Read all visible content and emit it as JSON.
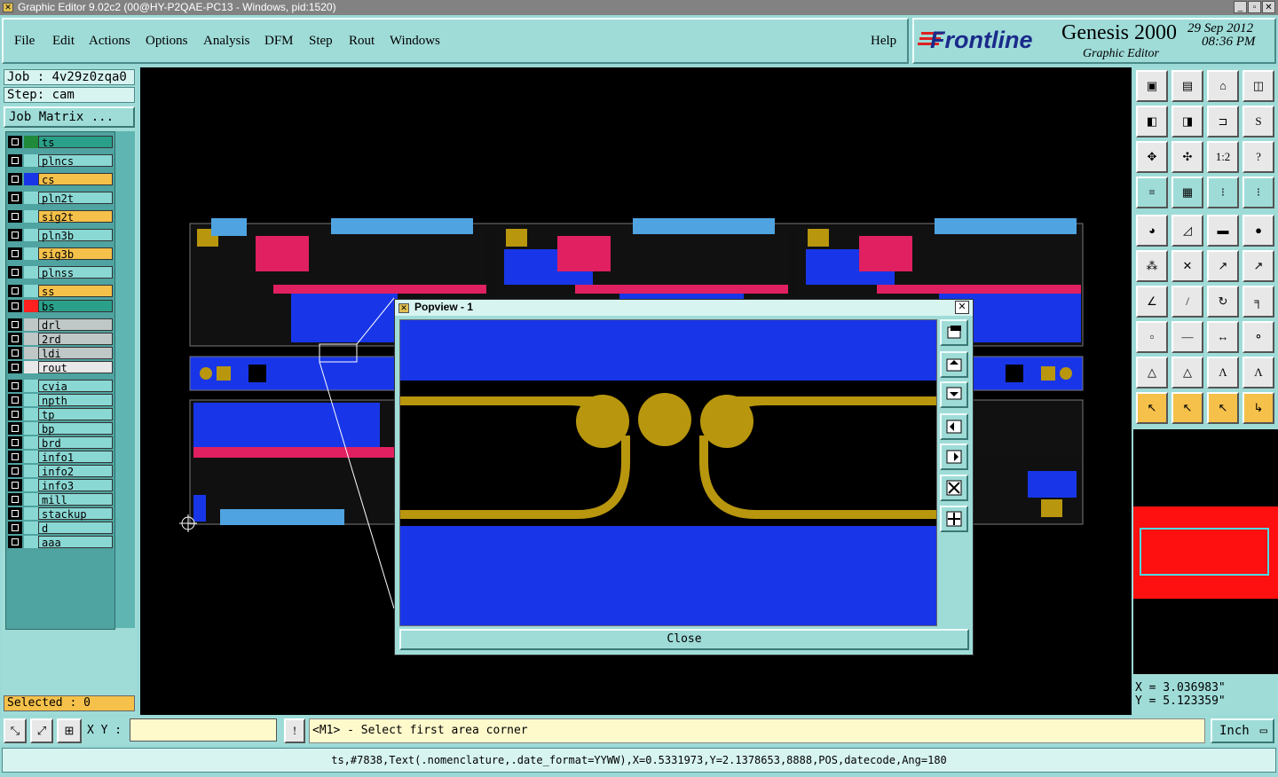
{
  "window": {
    "title": "Graphic Editor 9.02c2 (00@HY-P2QAE-PC13 - Windows, pid:1520)"
  },
  "menu": [
    "File",
    "Edit",
    "Actions",
    "Options",
    "Analysis",
    "DFM",
    "Step",
    "Rout",
    "Windows"
  ],
  "help_label": "Help",
  "brand": {
    "logo": "Frontline",
    "product": "Genesis 2000",
    "subtitle": "Graphic Editor",
    "date": "29 Sep 2012",
    "time": "08:36 PM"
  },
  "job": {
    "job_label": "Job : 4v29z0zqa0",
    "step_label": "Step: cam",
    "matrix_button": "Job Matrix ..."
  },
  "layers": [
    {
      "name": "ts",
      "color": "#1f8a3a",
      "bg": "#2aa08a"
    },
    {
      "name": "plncs",
      "color": "#8ad8d4",
      "bg": "#8ad8d4"
    },
    {
      "name": "cs",
      "color": "#1836e8",
      "bg": "#f5c14a"
    },
    {
      "name": "pln2t",
      "color": "#8ad8d4",
      "bg": "#8ad8d4"
    },
    {
      "name": "sig2t",
      "color": "#8ad8d4",
      "bg": "#f5c14a"
    },
    {
      "name": "pln3b",
      "color": "#8ad8d4",
      "bg": "#8ad8d4"
    },
    {
      "name": "sig3b",
      "color": "#8ad8d4",
      "bg": "#f5c14a"
    },
    {
      "name": "plnss",
      "color": "#8ad8d4",
      "bg": "#8ad8d4"
    },
    {
      "name": "ss",
      "color": "#8ad8d4",
      "bg": "#f5c14a"
    },
    {
      "name": "bs",
      "color": "#ff2020",
      "bg": "#2aa08a"
    },
    {
      "name": "drl",
      "color": "#bfc7c7",
      "bg": "#bfc7c7"
    },
    {
      "name": "2rd",
      "color": "#bfc7c7",
      "bg": "#bfc7c7"
    },
    {
      "name": "ldi",
      "color": "#bfc7c7",
      "bg": "#bfc7c7"
    },
    {
      "name": "rout",
      "color": "#e8e8e8",
      "bg": "#e8e8e8"
    },
    {
      "name": "cvia",
      "color": "#8ad8d4",
      "bg": "#8ad8d4"
    },
    {
      "name": "npth",
      "color": "#8ad8d4",
      "bg": "#8ad8d4"
    },
    {
      "name": "tp",
      "color": "#8ad8d4",
      "bg": "#8ad8d4"
    },
    {
      "name": "bp",
      "color": "#8ad8d4",
      "bg": "#8ad8d4"
    },
    {
      "name": "brd",
      "color": "#8ad8d4",
      "bg": "#8ad8d4"
    },
    {
      "name": "info1",
      "color": "#8ad8d4",
      "bg": "#8ad8d4"
    },
    {
      "name": "info2",
      "color": "#8ad8d4",
      "bg": "#8ad8d4"
    },
    {
      "name": "info3",
      "color": "#8ad8d4",
      "bg": "#8ad8d4"
    },
    {
      "name": "mill",
      "color": "#8ad8d4",
      "bg": "#8ad8d4"
    },
    {
      "name": "stackup",
      "color": "#8ad8d4",
      "bg": "#8ad8d4"
    },
    {
      "name": "d",
      "color": "#8ad8d4",
      "bg": "#8ad8d4"
    },
    {
      "name": "aaa",
      "color": "#8ad8d4",
      "bg": "#8ad8d4"
    }
  ],
  "selected_label": "Selected : 0",
  "popview": {
    "title": "Popview - 1",
    "close_label": "Close"
  },
  "coords": {
    "x": "X = 3.036983\"",
    "y": "Y = 5.123359\""
  },
  "status": {
    "xy_label": "X Y :",
    "xy_value": "",
    "prompt": "<M1> - Select first area corner",
    "units": "Inch"
  },
  "info_line": "ts,#7838,Text(.nomenclature,.date_format=YYWW),X=0.5331973,Y=2.1378653,8888,POS,datecode,Ang=180",
  "colors": {
    "panel": "#9fdcd8",
    "canvas": "#000000",
    "copper_blue": "#1836e8",
    "gold": "#b8960e",
    "highlight": "#f5c14a"
  }
}
